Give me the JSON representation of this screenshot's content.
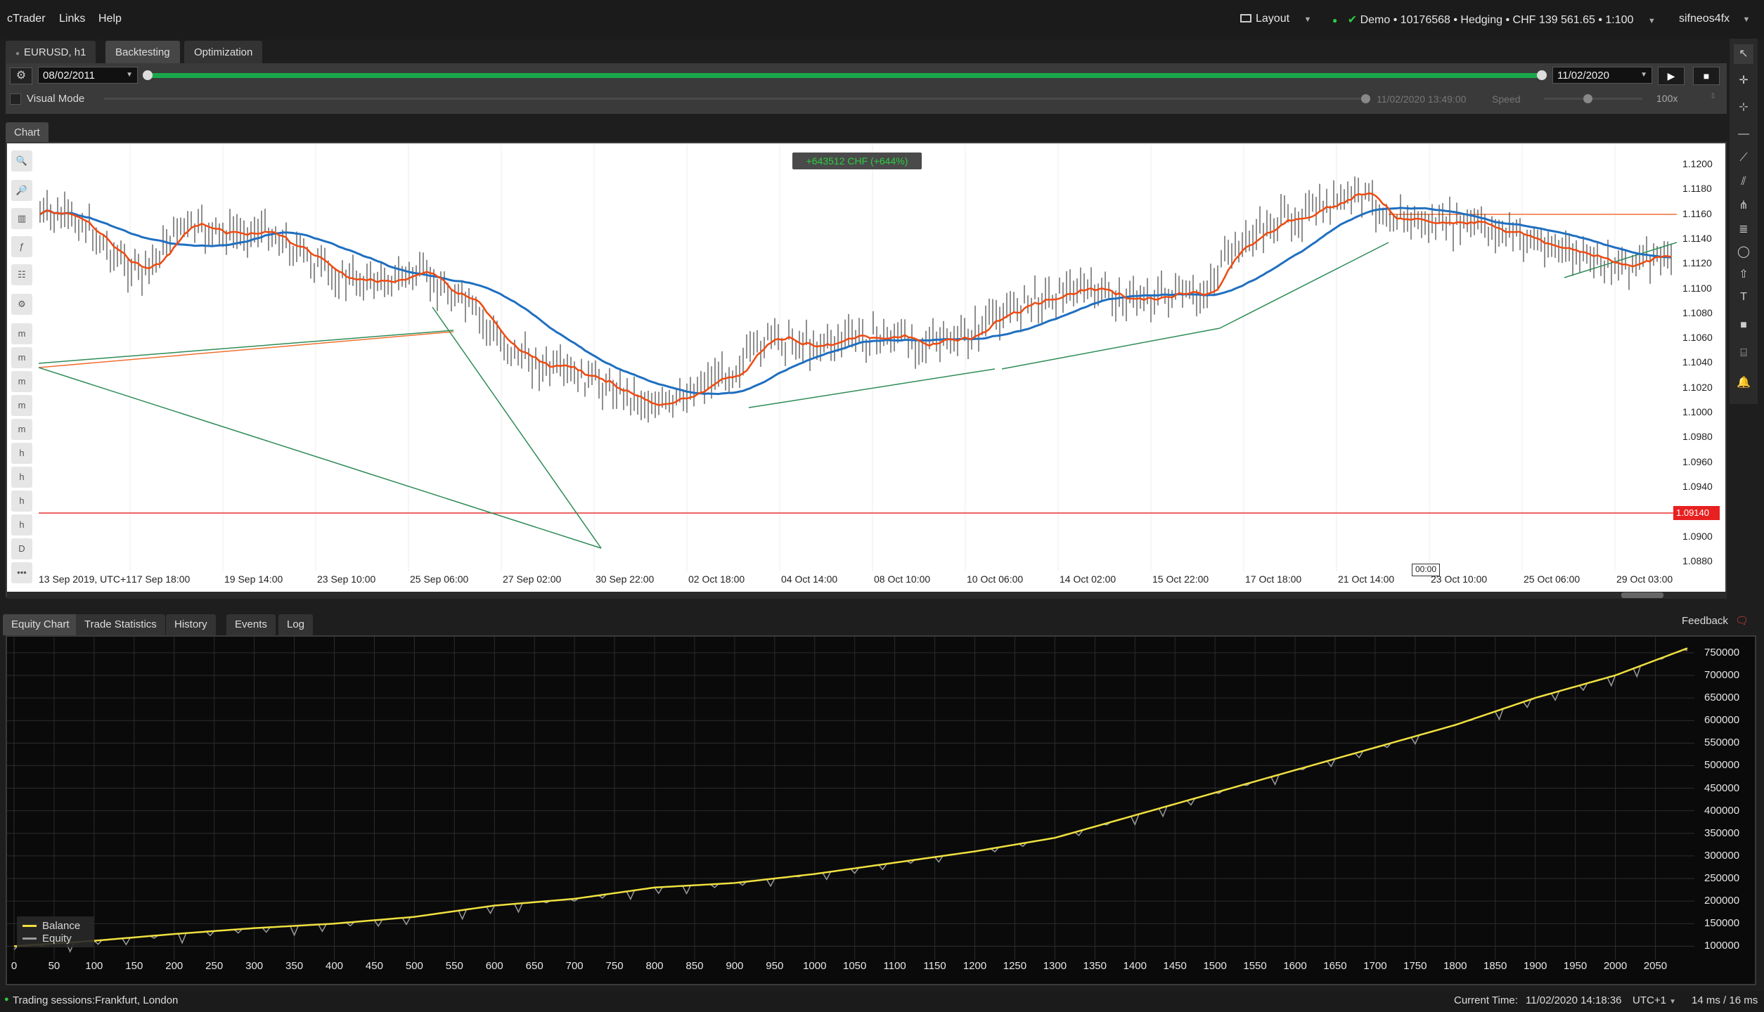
{
  "menu": {
    "app": "cTrader",
    "links": "Links",
    "help": "Help",
    "layout": "Layout",
    "user": "sifneos4fx"
  },
  "account": {
    "text": "Demo • 10176568 • Hedging • CHF 139 561.65 • 1:100"
  },
  "tabs": {
    "symbol": "EURUSD, h1",
    "backtesting": "Backtesting",
    "optimization": "Optimization"
  },
  "backtest": {
    "start_date": "08/02/2011",
    "end_date": "11/02/2020",
    "visual_mode": "Visual Mode",
    "current_time": "11/02/2020 13:49:00",
    "speed_label": "Speed",
    "speed_value": "100x",
    "progress": 1.0
  },
  "chart": {
    "tab": "Chart",
    "pnl_badge": "+643512 CHF (+644%)",
    "current_price": "1.09140",
    "time_marker": "00:00",
    "price_labels": [
      "1.1200",
      "1.1180",
      "1.1160",
      "1.1140",
      "1.1120",
      "1.1100",
      "1.1080",
      "1.1060",
      "1.1040",
      "1.1020",
      "1.1000",
      "1.0980",
      "1.0960",
      "1.0940",
      "1.0920",
      "1.0900",
      "1.0880"
    ],
    "time_labels": [
      "13 Sep 2019, UTC+1",
      "17 Sep 18:00",
      "19 Sep 14:00",
      "23 Sep 10:00",
      "25 Sep 06:00",
      "27 Sep 02:00",
      "30 Sep 22:00",
      "02 Oct 18:00",
      "04 Oct 14:00",
      "08 Oct 10:00",
      "10 Oct 06:00",
      "14 Oct 02:00",
      "15 Oct 22:00",
      "17 Oct 18:00",
      "21 Oct 14:00",
      "23 Oct 10:00",
      "25 Oct 06:00",
      "29 Oct 03:00"
    ],
    "left_tools": [
      "zoom-in",
      "zoom-out",
      "chart-type",
      "indicators",
      "templates",
      "settings",
      "m1",
      "m5",
      "m10",
      "m15",
      "m30",
      "h1",
      "h4",
      "h6",
      "h12",
      "D1",
      "more"
    ]
  },
  "bottom_tabs": {
    "equity": "Equity Chart",
    "stats": "Trade Statistics",
    "history": "History",
    "events": "Events",
    "log": "Log",
    "feedback": "Feedback"
  },
  "equity": {
    "legend": {
      "balance": "Balance",
      "equity": "Equity"
    },
    "colors": {
      "balance": "#f0e040",
      "equity": "#9a9a9a"
    },
    "chart_data": {
      "type": "line",
      "x": [
        0,
        100,
        200,
        300,
        400,
        500,
        600,
        700,
        800,
        900,
        1000,
        1100,
        1200,
        1300,
        1400,
        1500,
        1600,
        1700,
        1800,
        1900,
        2000,
        2090
      ],
      "series": [
        {
          "name": "Balance",
          "values": [
            100000,
            112000,
            127000,
            140000,
            150000,
            165000,
            190000,
            205000,
            230000,
            240000,
            260000,
            285000,
            310000,
            340000,
            390000,
            440000,
            490000,
            540000,
            590000,
            650000,
            700000,
            760000
          ]
        }
      ],
      "y_ticks": [
        750000,
        700000,
        650000,
        600000,
        550000,
        500000,
        450000,
        400000,
        350000,
        300000,
        250000,
        200000,
        150000,
        100000
      ],
      "x_ticks": [
        0,
        50,
        100,
        150,
        200,
        250,
        300,
        350,
        400,
        450,
        500,
        550,
        600,
        650,
        700,
        750,
        800,
        850,
        900,
        950,
        1000,
        1050,
        1100,
        1150,
        1200,
        1250,
        1300,
        1350,
        1400,
        1450,
        1500,
        1550,
        1600,
        1650,
        1700,
        1750,
        1800,
        1850,
        1900,
        1950,
        2000,
        2050
      ],
      "xlim": [
        0,
        2090
      ],
      "ylim": [
        85000,
        770000
      ],
      "legend": "bottom-left",
      "grid": true
    }
  },
  "status": {
    "sessions": "Trading sessions:Frankfurt, London",
    "current_time_label": "Current Time:",
    "current_time": "11/02/2020 14:18:36",
    "tz": "UTC+1",
    "latency": "14 ms / 16 ms"
  }
}
